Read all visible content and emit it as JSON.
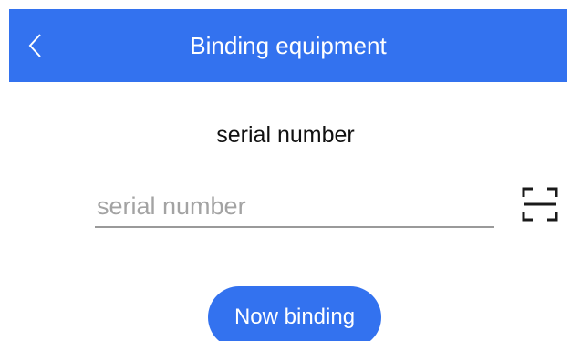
{
  "header": {
    "title": "Binding equipment",
    "back_icon": "chevron-left-icon",
    "background_color": "#3372ef"
  },
  "main": {
    "section_label": "serial number",
    "serial_input": {
      "value": "",
      "placeholder": "serial number"
    },
    "scan_icon": "scan-frame-icon",
    "bind_button_label": "Now binding",
    "accent_color": "#3372ef"
  }
}
